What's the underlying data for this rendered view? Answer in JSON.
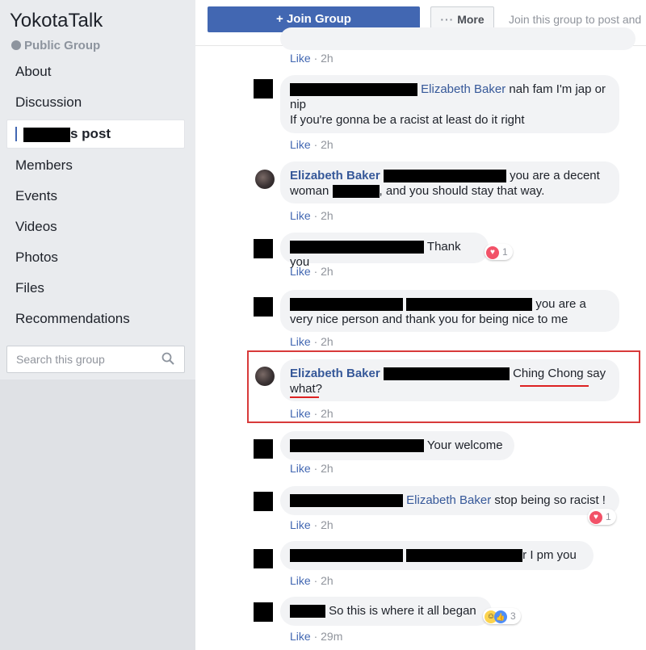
{
  "sidebar": {
    "group_name": "YokotaTalk",
    "group_type": "Public Group",
    "items": [
      {
        "label": "About"
      },
      {
        "label": "Discussion"
      },
      {
        "label": "s post"
      },
      {
        "label": "Members"
      },
      {
        "label": "Events"
      },
      {
        "label": "Videos"
      },
      {
        "label": "Photos"
      },
      {
        "label": "Files"
      },
      {
        "label": "Recommendations"
      }
    ],
    "search_placeholder": "Search this group"
  },
  "topbar": {
    "join_label": "+ Join Group",
    "more_label": "More",
    "note": "Join this group to post and"
  },
  "comments": [
    {
      "meta_like": "Like",
      "meta_time": "2h"
    },
    {
      "mention": "Elizabeth Baker",
      "text": "nah fam I'm jap or nip",
      "text2": "If you're gonna be a racist at least do it right",
      "meta_like": "Like",
      "meta_time": "2h"
    },
    {
      "author": "Elizabeth Baker",
      "text": "you are a decent woman",
      "text2": ", and you should stay that way.",
      "meta_like": "Like",
      "meta_time": "2h"
    },
    {
      "text": "Thank you",
      "reaction_count": "1",
      "meta_like": "Like",
      "meta_time": "2h"
    },
    {
      "text": "you are a very nice person and thank you for being nice to me",
      "meta_like": "Like",
      "meta_time": "2h"
    },
    {
      "author": "Elizabeth Baker",
      "text": "Ching Chong say what?",
      "meta_like": "Like",
      "meta_time": "2h"
    },
    {
      "text": "Your welcome",
      "meta_like": "Like",
      "meta_time": "2h"
    },
    {
      "mention": "Elizabeth Baker",
      "text": "stop being so racist !",
      "reaction_count": "1",
      "meta_like": "Like",
      "meta_time": "2h"
    },
    {
      "text": "r I pm you",
      "meta_like": "Like",
      "meta_time": "2h"
    },
    {
      "text": "So this is where it all began",
      "reaction_count": "3",
      "meta_like": "Like",
      "meta_time": "29m"
    }
  ],
  "colors": {
    "accent": "#4267b2",
    "link": "#365899",
    "highlight": "#d83a3a"
  }
}
